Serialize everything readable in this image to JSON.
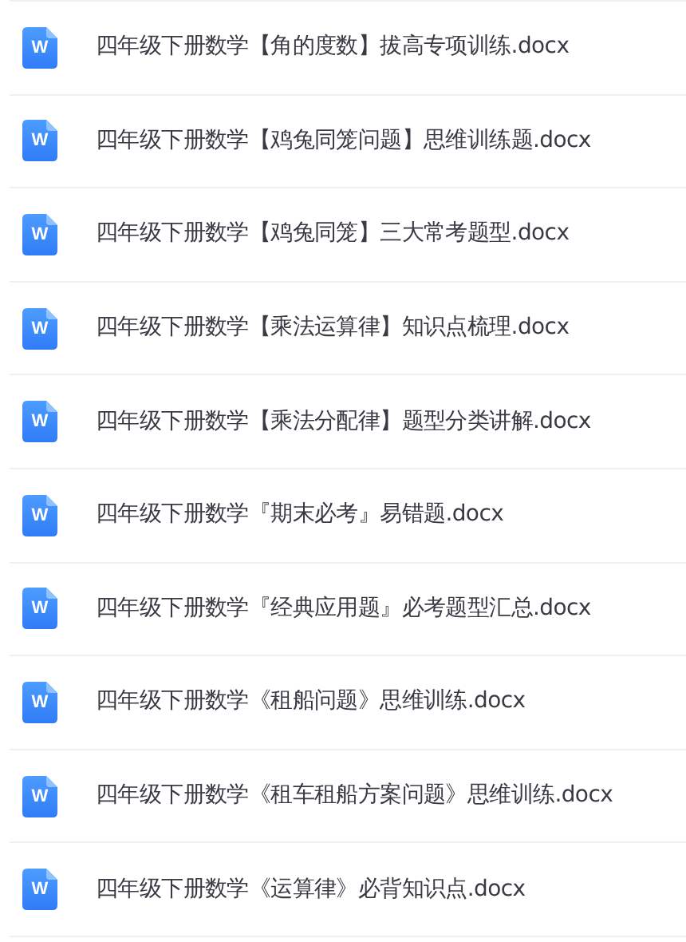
{
  "files": [
    {
      "icon_letter": "W",
      "name": "四年级下册数学【角的度数】拔高专项训练.docx"
    },
    {
      "icon_letter": "W",
      "name": "四年级下册数学【鸡兔同笼问题】思维训练题.docx"
    },
    {
      "icon_letter": "W",
      "name": "四年级下册数学【鸡兔同笼】三大常考题型.docx"
    },
    {
      "icon_letter": "W",
      "name": "四年级下册数学【乘法运算律】知识点梳理.docx"
    },
    {
      "icon_letter": "W",
      "name": "四年级下册数学【乘法分配律】题型分类讲解.docx"
    },
    {
      "icon_letter": "W",
      "name": "四年级下册数学『期末必考』易错题.docx"
    },
    {
      "icon_letter": "W",
      "name": "四年级下册数学『经典应用题』必考题型汇总.docx"
    },
    {
      "icon_letter": "W",
      "name": "四年级下册数学《租船问题》思维训练.docx"
    },
    {
      "icon_letter": "W",
      "name": "四年级下册数学《租车租船方案问题》思维训练.docx"
    },
    {
      "icon_letter": "W",
      "name": "四年级下册数学《运算律》必背知识点.docx"
    }
  ]
}
